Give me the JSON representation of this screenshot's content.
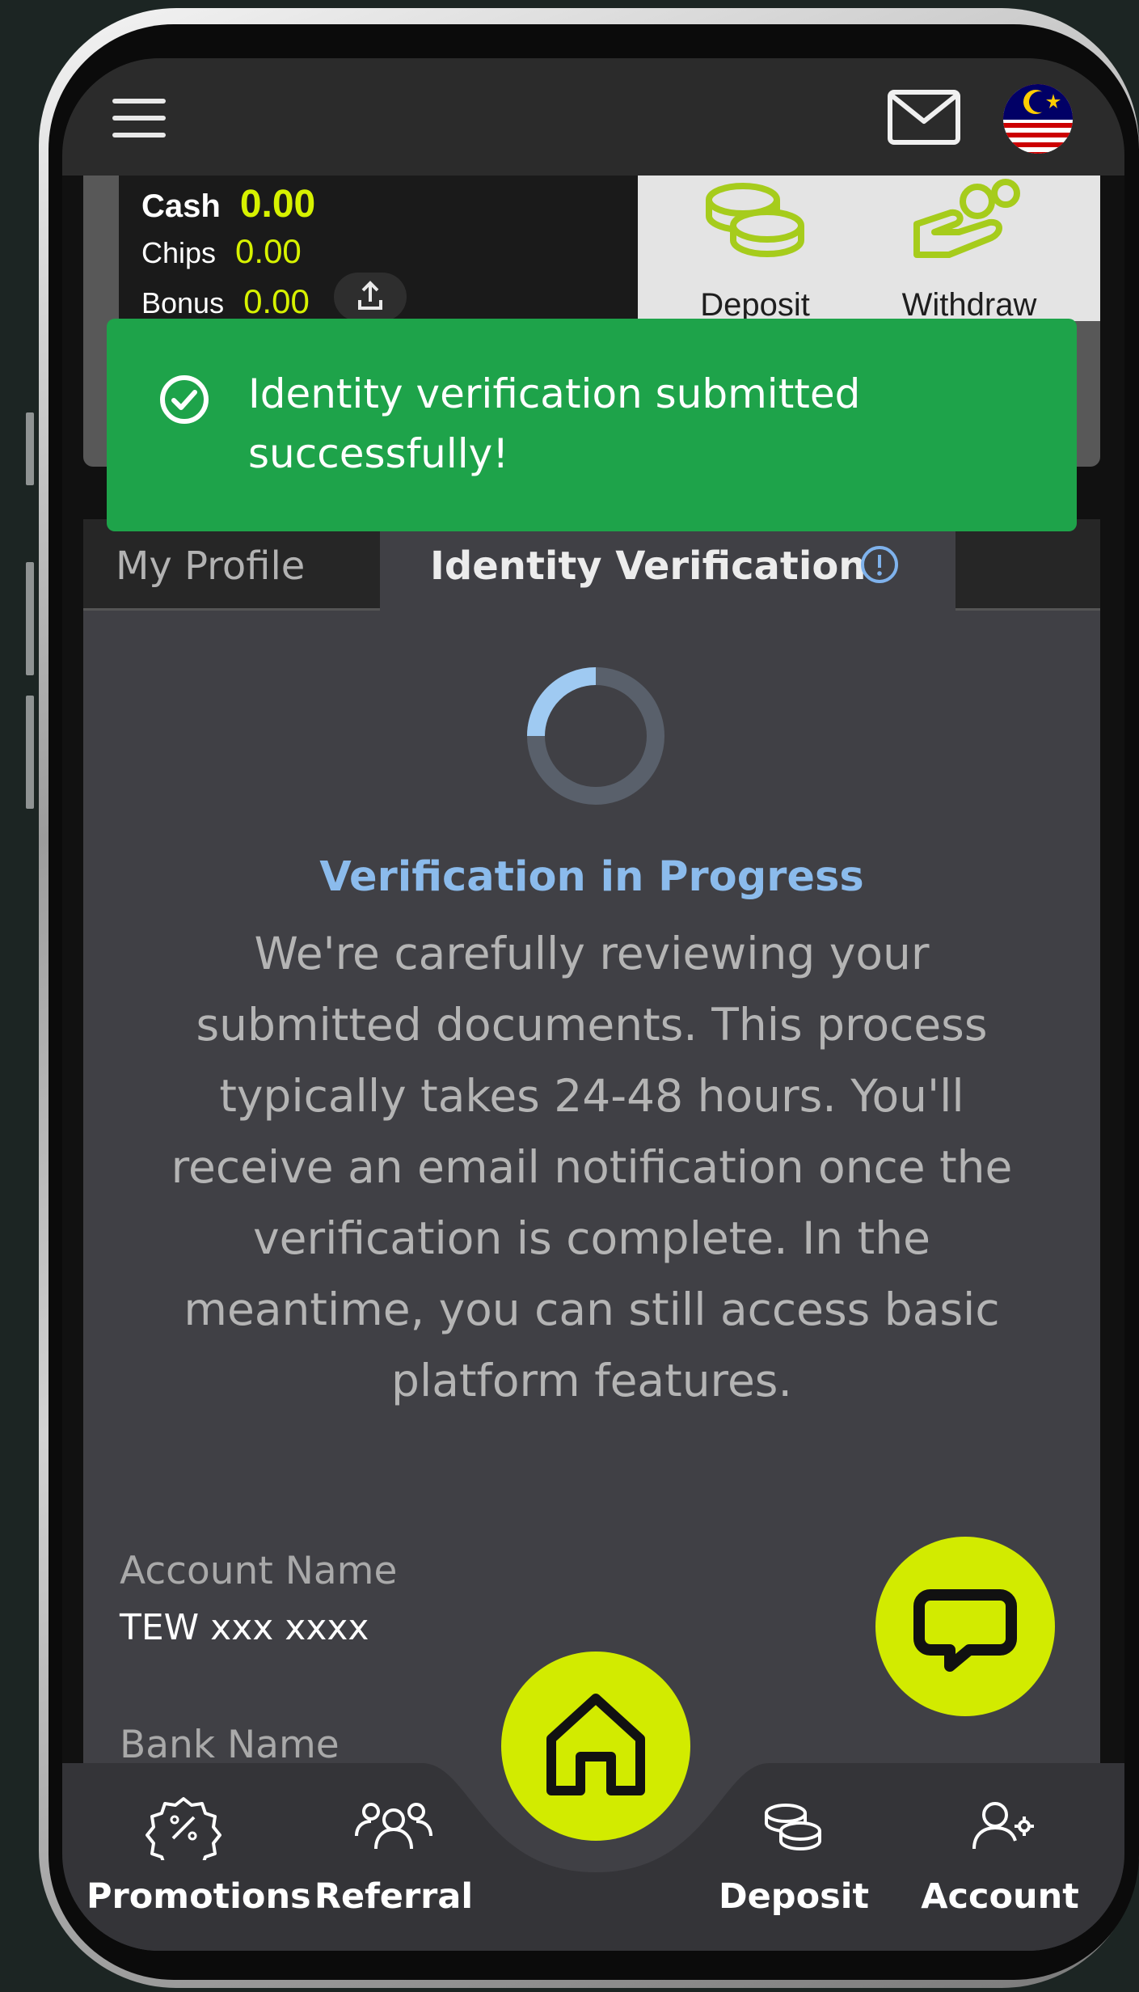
{
  "header": {
    "menu_icon": "hamburger-menu-icon",
    "mail_icon": "envelope-icon",
    "flag_icon": "malaysia-flag-icon"
  },
  "wallet": {
    "cash_label": "Cash",
    "cash_value": "0.00",
    "chips_label": "Chips",
    "chips_value": "0.00",
    "bonus_label": "Bonus",
    "bonus_value": "0.00",
    "deposit_label": "Deposit",
    "withdraw_label": "Withdraw"
  },
  "toast": {
    "message": "Identity verification submitted successfully!"
  },
  "tabs": [
    {
      "label": "My Profile"
    },
    {
      "label": "Identity Verification"
    }
  ],
  "verification": {
    "title": "Verification in Progress",
    "description": "We're carefully reviewing your submitted documents. This process typically takes 24-48 hours. You'll receive an email notification once the verification is complete. In the meantime, you can still access basic platform features."
  },
  "account": {
    "account_name_label": "Account Name",
    "account_name_value": "TEW xxx xxxx",
    "bank_name_label": "Bank Name"
  },
  "bottom_nav": {
    "items": [
      {
        "label": "Promotions",
        "icon": "percent-badge-icon"
      },
      {
        "label": "Referral",
        "icon": "users-icon"
      },
      {
        "label": "Deposit",
        "icon": "coins-icon"
      },
      {
        "label": "Account",
        "icon": "user-gear-icon"
      }
    ],
    "home_icon": "home-icon"
  },
  "colors": {
    "accent": "#d2eb00",
    "toast_bg": "#1ea34a",
    "title_blue": "#8bbbec"
  }
}
